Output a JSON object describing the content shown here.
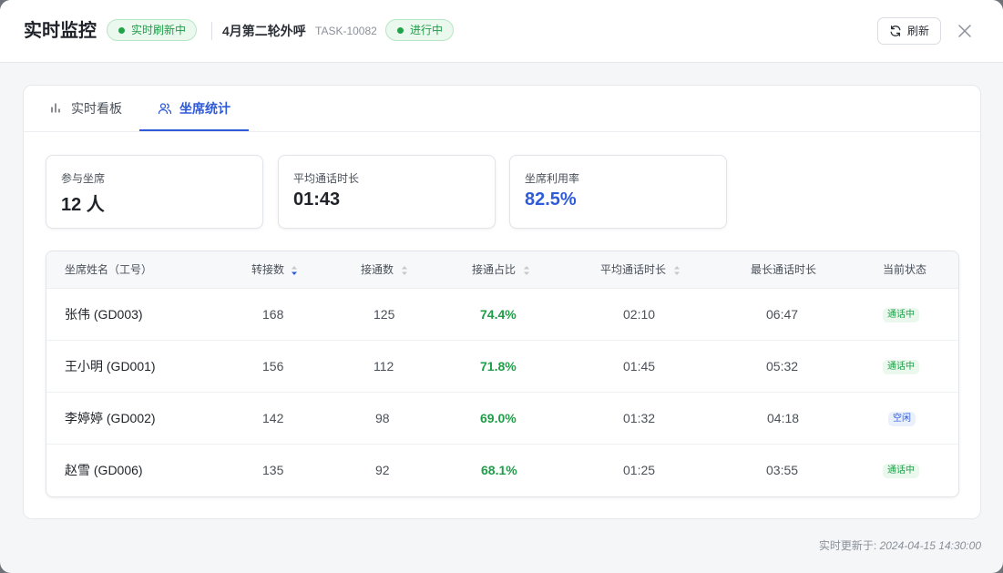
{
  "header": {
    "title": "实时监控",
    "live_badge": "实时刷新中",
    "task_name": "4月第二轮外呼",
    "task_id": "TASK-10082",
    "status_badge": "进行中",
    "refresh_label": "刷新",
    "close_icon": "close-icon"
  },
  "tabs": [
    {
      "label": "实时看板",
      "icon": "bar-chart-icon",
      "active": false
    },
    {
      "label": "坐席统计",
      "icon": "users-icon",
      "active": true
    }
  ],
  "stats": [
    {
      "label": "参与坐席",
      "value": "12 人"
    },
    {
      "label": "平均通话时长",
      "value": "01:43"
    },
    {
      "label": "坐席利用率",
      "value": "82.5%"
    }
  ],
  "table": {
    "columns": [
      "坐席姓名（工号）",
      "转接数",
      "接通数",
      "接通占比",
      "平均通话时长",
      "最长通话时长",
      "当前状态"
    ],
    "rows": [
      {
        "name": "张伟 (GD003)",
        "transfers": "168",
        "connected": "125",
        "rate": "74.4%",
        "avg": "02:10",
        "max": "06:47",
        "status": "通话中"
      },
      {
        "name": "王小明 (GD001)",
        "transfers": "156",
        "connected": "112",
        "rate": "71.8%",
        "avg": "01:45",
        "max": "05:32",
        "status": "通话中"
      },
      {
        "name": "李婷婷 (GD002)",
        "transfers": "142",
        "connected": "98",
        "rate": "69.0%",
        "avg": "01:32",
        "max": "04:18",
        "status": "空闲"
      },
      {
        "name": "赵雪 (GD006)",
        "transfers": "135",
        "connected": "92",
        "rate": "68.1%",
        "avg": "01:25",
        "max": "03:55",
        "status": "通话中"
      }
    ]
  },
  "footer": {
    "prefix": "实时更新于:",
    "timestamp": "2024-04-15 14:30:00"
  },
  "colors": {
    "accent": "#2f5bd9",
    "success": "#1f9d48"
  }
}
